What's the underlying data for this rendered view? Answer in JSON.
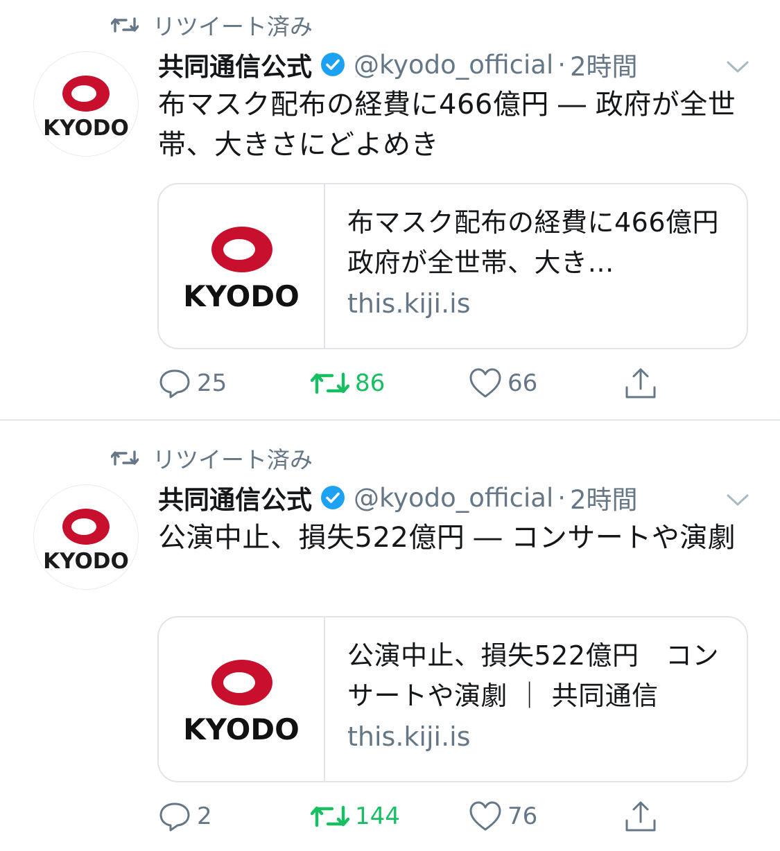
{
  "colors": {
    "text_primary": "#14171a",
    "text_secondary": "#657786",
    "verified_blue": "#1da1f2",
    "retweet_green": "#17bf63",
    "kyodo_red": "#c8102e",
    "divider": "#e1e8ed"
  },
  "icons": {
    "retweet": "retweet-icon",
    "verified": "verified-badge-icon",
    "caret": "chevron-down-icon",
    "reply": "reply-icon",
    "like": "heart-icon",
    "share": "share-icon"
  },
  "tweets": [
    {
      "retweet_label": "リツイート済み",
      "display_name": "共同通信公式",
      "handle": "@kyodo_official",
      "separator": "·",
      "time": "2時間",
      "text": "布マスク配布の経費に466億円 ― 政府が全世帯、大きさにどよめき",
      "avatar_logo_text": "KYODO",
      "card": {
        "logo_text": "KYODO",
        "title": "布マスク配布の経費に466億円　政府が全世帯、大き…",
        "domain": "this.kiji.is"
      },
      "actions": {
        "replies": "25",
        "retweets": "86",
        "likes": "66",
        "retweeted": true,
        "liked": false
      }
    },
    {
      "retweet_label": "リツイート済み",
      "display_name": "共同通信公式",
      "handle": "@kyodo_official",
      "separator": "·",
      "time": "2時間",
      "text": "公演中止、損失522億円 ― コンサートや演劇",
      "avatar_logo_text": "KYODO",
      "card": {
        "logo_text": "KYODO",
        "title": "公演中止、損失522億円　コンサートや演劇 ｜ 共同通信",
        "domain": "this.kiji.is"
      },
      "actions": {
        "replies": "2",
        "retweets": "144",
        "likes": "76",
        "retweeted": true,
        "liked": false
      }
    }
  ]
}
